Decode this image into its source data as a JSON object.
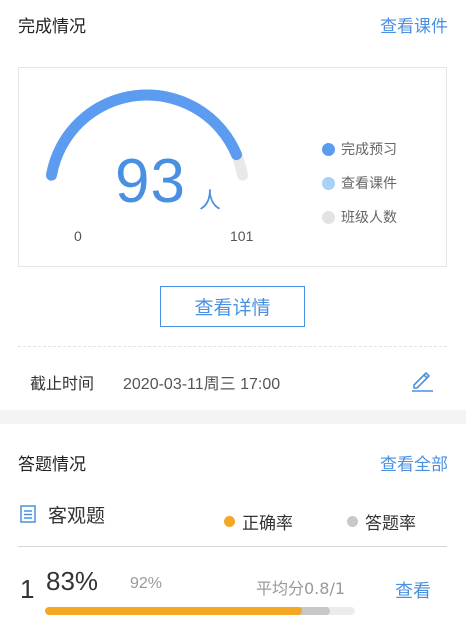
{
  "completion": {
    "title": "完成情况",
    "view_courseware_link": "查看课件",
    "count": "93",
    "unit": "人",
    "min": "0",
    "max": "101",
    "value": 93,
    "range": [
      0,
      101
    ],
    "legend": [
      {
        "label": "完成预习",
        "color": "#5b9cf0"
      },
      {
        "label": "查看课件",
        "color": "#a9d1f7"
      },
      {
        "label": "班级人数",
        "color": "#e3e3e3"
      }
    ],
    "detail_button": "查看详情",
    "deadline_label": "截止时间",
    "deadline_value": "2020-03-11周三 17:00"
  },
  "answers": {
    "title": "答题情况",
    "view_all_link": "查看全部",
    "subtitle": "客观题",
    "legend": [
      {
        "label": "正确率",
        "color": "#f5a623"
      },
      {
        "label": "答题率",
        "color": "#c8c8c8"
      }
    ],
    "rows": [
      {
        "index": "1",
        "correct_rate": "83%",
        "answer_rate": "92%",
        "avg_score": "平均分0.8/1",
        "view_label": "查看",
        "correct_fraction": 0.83,
        "answer_fraction": 0.92
      }
    ]
  },
  "colors": {
    "accent": "#4a90e2",
    "gauge_track": "#e9e9e9",
    "gauge_fill": "#5b9cf0"
  }
}
